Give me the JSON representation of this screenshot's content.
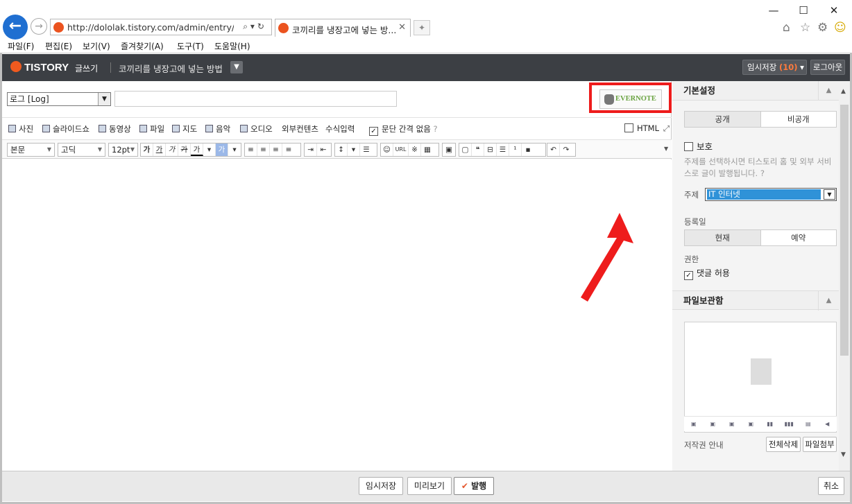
{
  "browser": {
    "url": "http://dololak.tistory.com/admin/entry/post/",
    "tab_title": "코끼리를 냉장고에 넣는 방...",
    "menu": [
      "파일(F)",
      "편집(E)",
      "보기(V)",
      "즐겨찾기(A)",
      "도구(T)",
      "도움말(H)"
    ]
  },
  "header": {
    "logo": "TISTORY",
    "mode": "글쓰기",
    "post_title": "코끼리를 냉장고에 넣는 방법",
    "draft_label": "임시저장",
    "draft_count": "(10)",
    "logout": "로그아웃"
  },
  "editor": {
    "category": "로그 [Log]",
    "evernote": "EVERNOTE",
    "toolbar": [
      "사진",
      "슬라이드쇼",
      "동영상",
      "파일",
      "지도",
      "음악",
      "오디오",
      "외부컨텐츠",
      "수식입력"
    ],
    "paragraph_option": "문단 간격 없음",
    "html_label": "HTML",
    "style_select": "본문",
    "font_select": "고딕",
    "size_select": "12pt",
    "fmt_buttons": [
      "가",
      "가",
      "가",
      "가",
      "가"
    ],
    "highlight_btn": "가",
    "url_btn": "URL"
  },
  "sidebar": {
    "basic_heading": "기본설정",
    "visibility": [
      "공개",
      "비공개"
    ],
    "protect_label": "보호",
    "topic_hint": "주제를 선택하시면 티스토리 홈 및 외부 서비스로 글이 발행됩니다.",
    "topic_label": "주제",
    "topic_value": "IT 인터넷",
    "date_label": "등록일",
    "date_options": [
      "현재",
      "예약"
    ],
    "perm_label": "권한",
    "comment_label": "댓글 허용",
    "files_heading": "파일보관함",
    "copyright": "저작권 안내",
    "delete_all": "전체삭제",
    "attach": "파일첨부"
  },
  "footer": {
    "save": "임시저장",
    "preview": "미리보기",
    "publish": "발행",
    "cancel": "취소"
  }
}
